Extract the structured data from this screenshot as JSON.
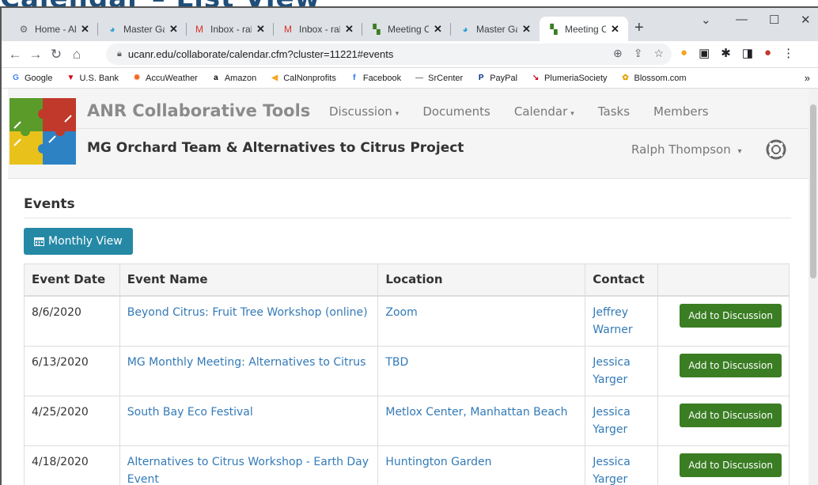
{
  "slide_title": "Calendar – List View",
  "browser": {
    "tabs": [
      {
        "label": "Home - All",
        "icon": "settings-tab-icon",
        "color": "#5f6368"
      },
      {
        "label": "Master Gardener",
        "icon": "master-gardener-tab-icon",
        "color": "#2a9fd6"
      },
      {
        "label": "Inbox - ral",
        "icon": "gmail-tab-icon",
        "color": "#d93025"
      },
      {
        "label": "Inbox - ral",
        "icon": "gmail-tab-icon",
        "color": "#d93025"
      },
      {
        "label": "Meeting C",
        "icon": "puzzle-tab-icon",
        "color": "#3a7d23"
      },
      {
        "label": "Master Ga",
        "icon": "master-gardener-tab-icon",
        "color": "#2a9fd6"
      },
      {
        "label": "Meeting C",
        "icon": "puzzle-tab-icon",
        "color": "#3a7d23",
        "active": true
      }
    ],
    "url": "ucanr.edu/collaborate/calendar.cfm?cluster=11221#events",
    "bookmarks": [
      {
        "label": "Google",
        "icon": "google-icon",
        "glyph": "G",
        "color": "#4285f4"
      },
      {
        "label": "U.S. Bank",
        "icon": "usbank-icon",
        "glyph": "▼",
        "color": "#d0021b"
      },
      {
        "label": "AccuWeather",
        "icon": "accuweather-icon",
        "glyph": "✹",
        "color": "#f26522"
      },
      {
        "label": "Amazon",
        "icon": "amazon-icon",
        "glyph": "a",
        "color": "#000000"
      },
      {
        "label": "CalNonprofits",
        "icon": "calnonprofits-icon",
        "glyph": "◀",
        "color": "#f5a623"
      },
      {
        "label": "Facebook",
        "icon": "facebook-icon",
        "glyph": "f",
        "color": "#1877f2"
      },
      {
        "label": "SrCenter",
        "icon": "srcenter-icon",
        "glyph": "—",
        "color": "#777777"
      },
      {
        "label": "PayPal",
        "icon": "paypal-icon",
        "glyph": "P",
        "color": "#003087"
      },
      {
        "label": "PlumeriaSociety",
        "icon": "plumeria-icon",
        "glyph": "↘",
        "color": "#d0021b"
      },
      {
        "label": "Blossom.com",
        "icon": "blossom-icon",
        "glyph": "✿",
        "color": "#e5a000"
      }
    ]
  },
  "site": {
    "brand": "ANR Collaborative Tools",
    "nav": [
      {
        "label": "Discussion",
        "caret": "▾"
      },
      {
        "label": "Documents",
        "caret": ""
      },
      {
        "label": "Calendar",
        "caret": "▾"
      },
      {
        "label": "Tasks",
        "caret": ""
      },
      {
        "label": "Members",
        "caret": ""
      }
    ],
    "project_title": "MG Orchard Team & Alternatives to Citrus Project",
    "user": "Ralph Thompson",
    "user_caret": "▾"
  },
  "events": {
    "heading": "Events",
    "monthly_button": "Monthly View",
    "columns": [
      "Event Date",
      "Event Name",
      "Location",
      "Contact",
      ""
    ],
    "add_label": "Add to Discussion",
    "rows": [
      {
        "date": "8/6/2020",
        "name": "Beyond Citrus: Fruit Tree Workshop (online)",
        "location": "Zoom",
        "contact": "Jeffrey Warner"
      },
      {
        "date": "6/13/2020",
        "name": "MG Monthly Meeting: Alternatives to Citrus",
        "location": "TBD",
        "contact": "Jessica Yarger"
      },
      {
        "date": "4/25/2020",
        "name": "South Bay Eco Festival",
        "location": "Metlox Center, Manhattan Beach",
        "contact": "Jessica Yarger"
      },
      {
        "date": "4/18/2020",
        "name": "Alternatives to Citrus Workshop - Earth Day Event",
        "location": "Huntington Garden",
        "contact": "Jessica Yarger"
      }
    ]
  },
  "colors": {
    "accent": "#2589a6",
    "add_button": "#3a7d23",
    "link": "#337ab7"
  }
}
